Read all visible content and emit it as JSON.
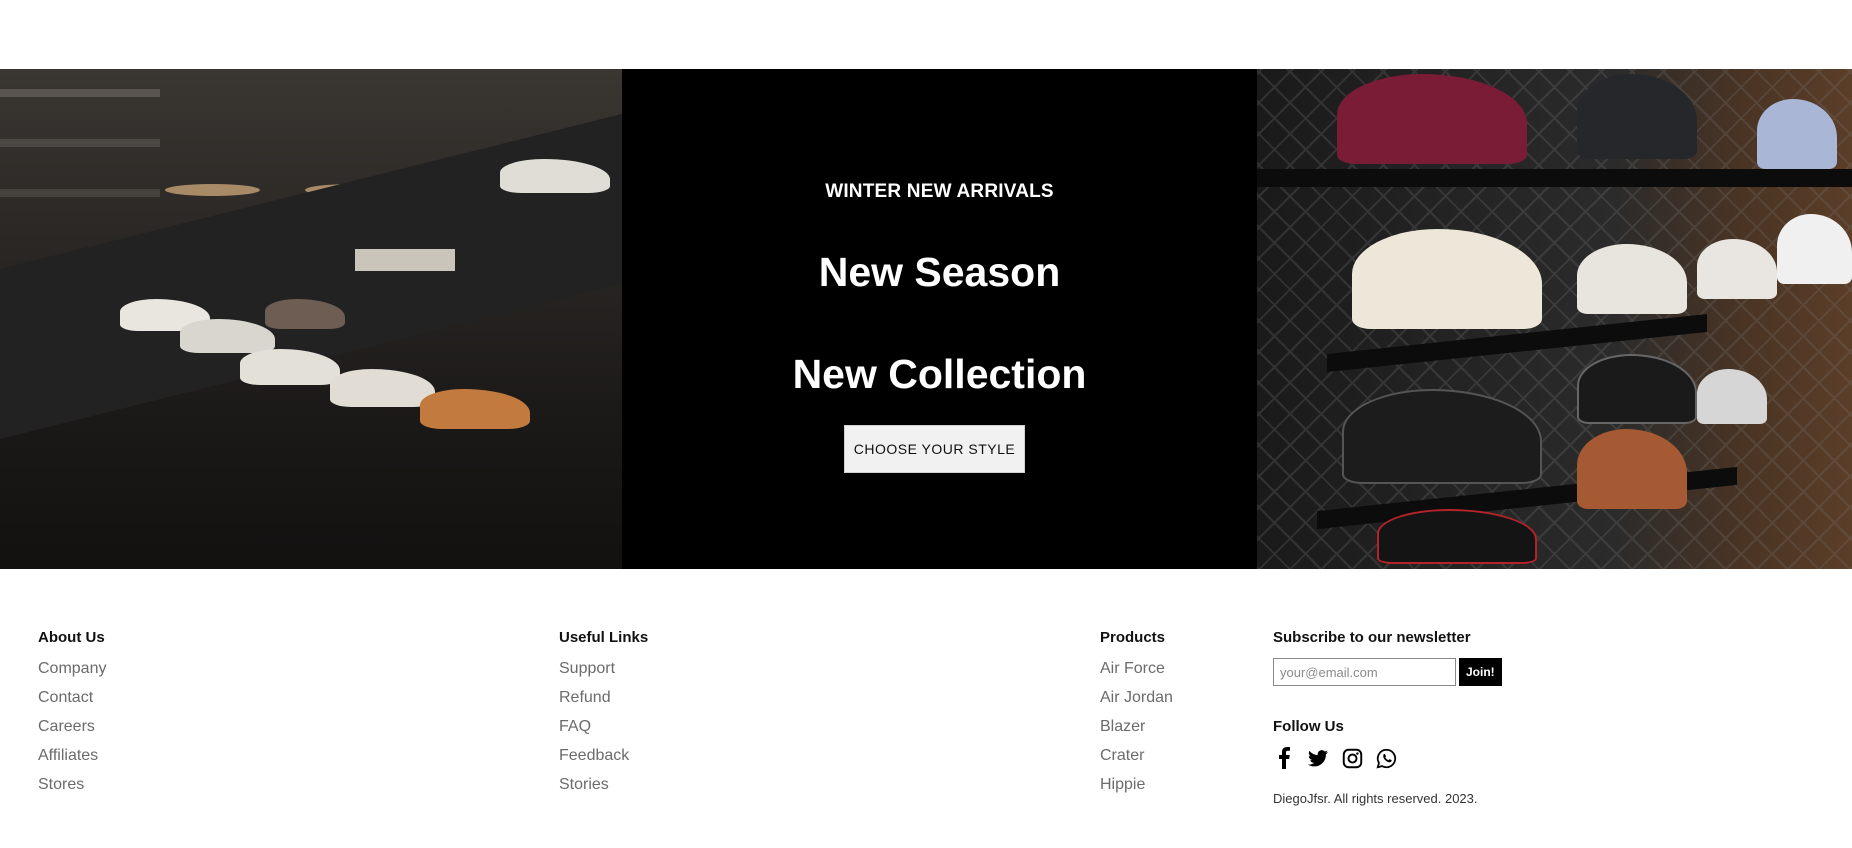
{
  "hero": {
    "kicker": "WINTER NEW ARRIVALS",
    "line1": "New Season",
    "line2": "New Collection",
    "button": "CHOOSE YOUR STYLE"
  },
  "footer": {
    "about": {
      "title": "About Us",
      "items": [
        "Company",
        "Contact",
        "Careers",
        "Affiliates",
        "Stores"
      ]
    },
    "links": {
      "title": "Useful Links",
      "items": [
        "Support",
        "Refund",
        "FAQ",
        "Feedback",
        "Stories"
      ]
    },
    "products": {
      "title": "Products",
      "items": [
        "Air Force",
        "Air Jordan",
        "Blazer",
        "Crater",
        "Hippie"
      ]
    },
    "newsletter": {
      "title": "Subscribe to our newsletter",
      "placeholder": "your@email.com",
      "button": "Join!"
    },
    "follow": {
      "title": "Follow Us",
      "icons": [
        "facebook-icon",
        "twitter-icon",
        "instagram-icon",
        "whatsapp-icon"
      ]
    },
    "copyright": "DiegoJfsr. All rights reserved. 2023."
  }
}
